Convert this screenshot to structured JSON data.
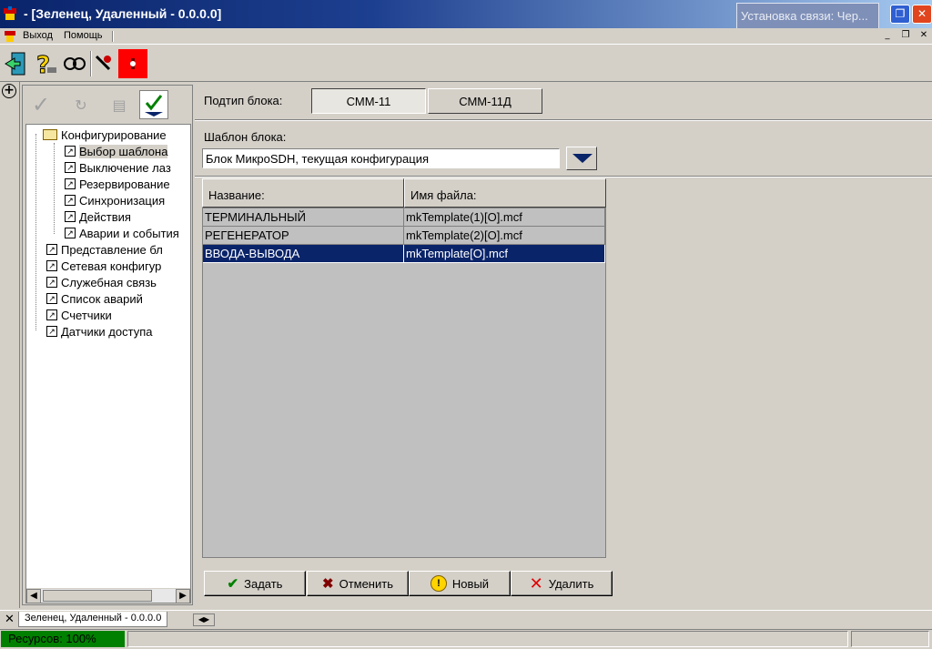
{
  "window": {
    "title": "- [Зеленец, Удаленный - 0.0.0.0]",
    "connect_window_title": "Установка связи: Чер...",
    "minimize_icon": "restore-icon",
    "close_icon": "close-icon"
  },
  "menu": {
    "items": [
      "Выход",
      "Помощь"
    ]
  },
  "toolbar": {
    "buttons": [
      "exit-door-icon",
      "help-question-icon",
      "connect-plug-icon",
      "settings-tools-icon",
      "alarm-red-icon"
    ]
  },
  "tree_toolbar": {
    "buttons": [
      "apply-check-icon",
      "refresh-icon",
      "trash-icon",
      "download-check-icon"
    ]
  },
  "tree": {
    "root": "Конфигурирование",
    "children": [
      "Выбор шаблона",
      "Выключение лаз",
      "Резервирование",
      "Синхронизация",
      "Действия",
      "Аварии и события"
    ],
    "items": [
      "Представление бл",
      "Сетевая конфигур",
      "Служебная связь",
      "Список аварий",
      "Счетчики",
      "Датчики доступа"
    ]
  },
  "main": {
    "subtype_label": "Подтип блока:",
    "subtype_buttons": [
      "СММ-11",
      "СММ-11Д"
    ],
    "template_label": "Шаблон блока:",
    "template_value": "Блок МикроSDH, текущая конфигурация",
    "columns": [
      "Название:",
      "Имя файла:"
    ],
    "rows": [
      {
        "name": "ТЕРМИНАЛЬНЫЙ",
        "file": "mkTemplate(1)[O].mcf"
      },
      {
        "name": "РЕГЕНЕРАТОР",
        "file": "mkTemplate(2)[O].mcf"
      },
      {
        "name": "ВВОДА-ВЫВОДА",
        "file": "mkTemplate[O].mcf"
      }
    ],
    "selected_row": 2,
    "buttons": {
      "set": "Задать",
      "cancel": "Отменить",
      "new": "Новый",
      "delete": "Удалить"
    }
  },
  "tabs": {
    "active": "Зеленец, Удаленный - 0.0.0.0"
  },
  "status": {
    "resources": "Ресурсов: 100%"
  },
  "colors": {
    "selection": "#0a246a",
    "status_green": "#008000",
    "face": "#d4d0c8"
  }
}
